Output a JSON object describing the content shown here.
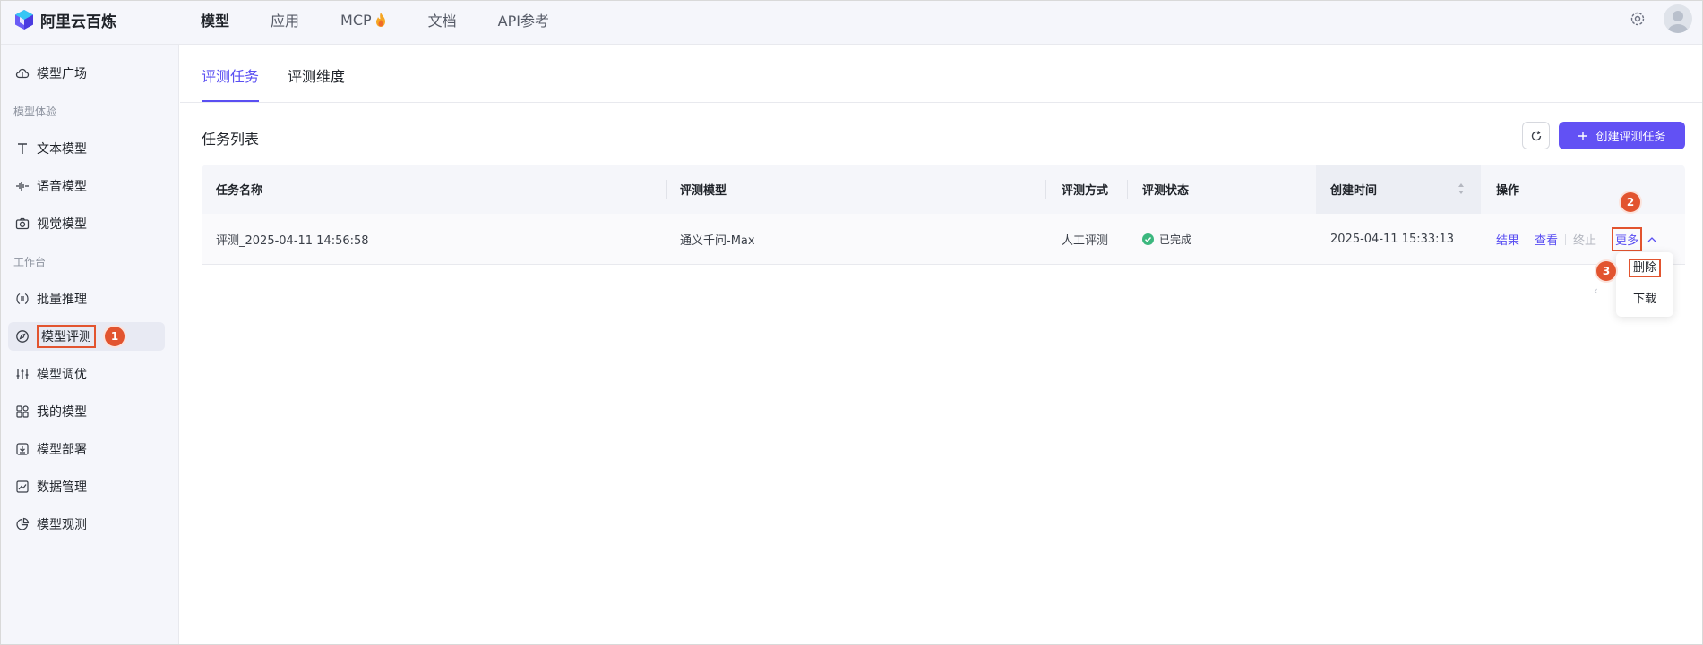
{
  "brand": {
    "name": "阿里云百炼"
  },
  "topnav": {
    "items": [
      {
        "label": "模型",
        "active": true
      },
      {
        "label": "应用",
        "active": false
      },
      {
        "label": "MCP",
        "active": false,
        "icon": "fire-icon"
      },
      {
        "label": "文档",
        "active": false
      },
      {
        "label": "API参考",
        "active": false
      }
    ]
  },
  "sidebar": {
    "items": [
      {
        "label": "模型广场",
        "icon": "cloud-icon"
      },
      {
        "group": "模型体验"
      },
      {
        "label": "文本模型",
        "icon": "text-icon"
      },
      {
        "label": "语音模型",
        "icon": "waveform-icon"
      },
      {
        "label": "视觉模型",
        "icon": "camera-icon"
      },
      {
        "group": "工作台"
      },
      {
        "label": "批量推理",
        "icon": "list-circle-icon"
      },
      {
        "label": "模型评测",
        "icon": "compass-icon",
        "active": true
      },
      {
        "label": "模型调优",
        "icon": "sliders-icon"
      },
      {
        "label": "我的模型",
        "icon": "grid-icon"
      },
      {
        "label": "模型部署",
        "icon": "download-box-icon"
      },
      {
        "label": "数据管理",
        "icon": "chart-icon"
      },
      {
        "label": "模型观测",
        "icon": "pie-icon"
      }
    ]
  },
  "tabs": [
    {
      "label": "评测任务",
      "active": true
    },
    {
      "label": "评测维度",
      "active": false
    }
  ],
  "section_title": "任务列表",
  "create_button": "创建评测任务",
  "table": {
    "columns": [
      "任务名称",
      "评测模型",
      "评测方式",
      "评测状态",
      "创建时间",
      "操作"
    ],
    "rows": [
      {
        "name": "评测_2025-04-11 14:56:58",
        "model": "通义千问-Max",
        "method": "人工评测",
        "status": "已完成",
        "created": "2025-04-11 15:33:13",
        "actions": [
          "结果",
          "查看",
          "终止",
          "更多"
        ]
      }
    ]
  },
  "dropdown": {
    "items": [
      "删除",
      "下载"
    ]
  },
  "annotations": [
    "1",
    "2",
    "3"
  ],
  "colors": {
    "accent": "#5a4ff2",
    "highlight": "#e2542f",
    "success": "#3bb77e"
  }
}
